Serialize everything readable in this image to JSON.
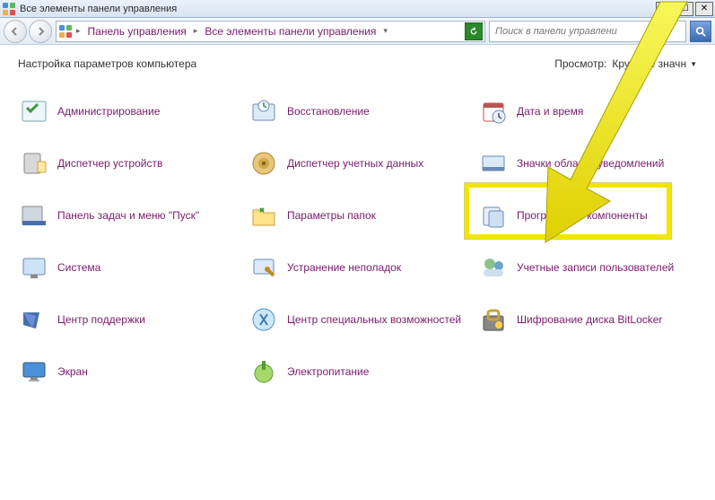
{
  "window": {
    "title": "Все элементы панели управления"
  },
  "breadcrumb": {
    "items": [
      "Панель управления",
      "Все элементы панели управления"
    ]
  },
  "search": {
    "placeholder": "Поиск в панели управлени"
  },
  "content": {
    "heading": "Настройка параметров компьютера",
    "view_label": "Просмотр:",
    "view_value": "Крупные значн"
  },
  "items": [
    {
      "id": "administration",
      "label": "Администрирование",
      "icon": "admin"
    },
    {
      "id": "recovery",
      "label": "Восстановление",
      "icon": "recovery"
    },
    {
      "id": "date-time",
      "label": "Дата и время",
      "icon": "datetime"
    },
    {
      "id": "device-manager",
      "label": "Диспетчер устройств",
      "icon": "devmgr"
    },
    {
      "id": "credential-manager",
      "label": "Диспетчер учетных данных",
      "icon": "credmgr"
    },
    {
      "id": "notification-icons",
      "label": "Значки области уведомлений",
      "icon": "notify"
    },
    {
      "id": "taskbar",
      "label": "Панель задач и меню \"Пуск\"",
      "icon": "taskbar"
    },
    {
      "id": "folder-options",
      "label": "Параметры папок",
      "icon": "folder"
    },
    {
      "id": "programs",
      "label": "Программы и компоненты",
      "icon": "programs"
    },
    {
      "id": "system",
      "label": "Система",
      "icon": "system"
    },
    {
      "id": "troubleshoot",
      "label": "Устранение неполадок",
      "icon": "troubleshoot"
    },
    {
      "id": "users",
      "label": "Учетные записи пользователей",
      "icon": "users"
    },
    {
      "id": "action-center",
      "label": "Центр поддержки",
      "icon": "action"
    },
    {
      "id": "ease-of-access",
      "label": "Центр специальных возможностей",
      "icon": "ease"
    },
    {
      "id": "bitlocker",
      "label": "Шифрование диска BitLocker",
      "icon": "bitlocker"
    },
    {
      "id": "display",
      "label": "Экран",
      "icon": "display"
    },
    {
      "id": "power",
      "label": "Электропитание",
      "icon": "power"
    }
  ],
  "annotations": {
    "highlight_target_id": "programs",
    "arrow_origin": "top-right"
  },
  "colors": {
    "link": "#7a1a6b",
    "highlight": "#f2e600"
  }
}
